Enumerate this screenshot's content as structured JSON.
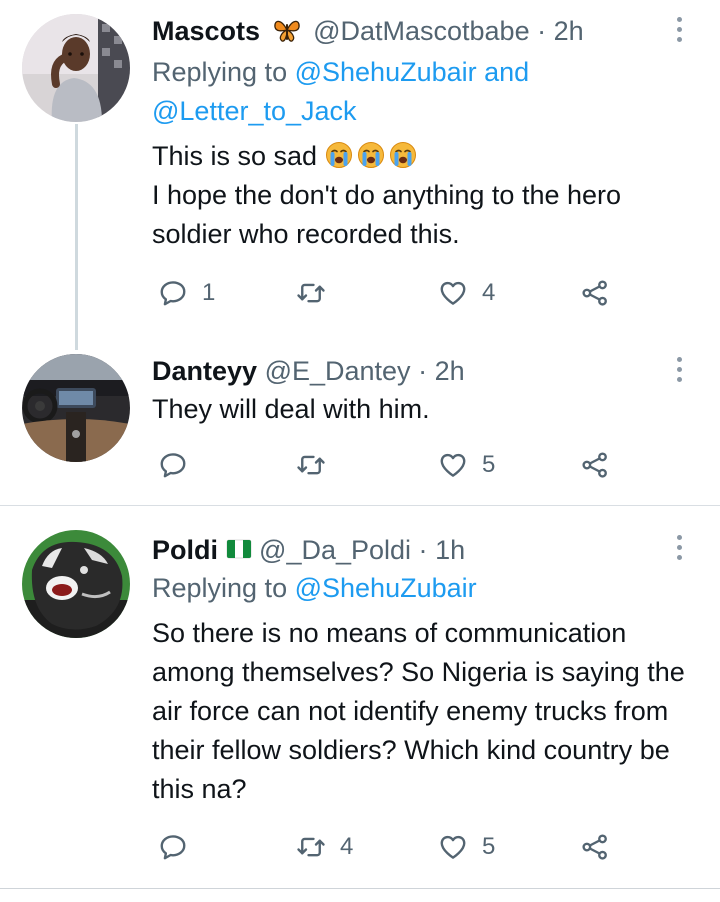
{
  "tweets": [
    {
      "name": "Mascots",
      "name_emoji": "butterfly-emoji",
      "handle": "@DatMascotbabe",
      "dot": "·",
      "time": "2h",
      "replying_prefix": "Replying to",
      "replying_to_1": "@ShehuZubair",
      "replying_and": "and",
      "replying_to_2": "@Letter_to_Jack",
      "text_line1": "This is so sad",
      "text_line1_emoji": "crying-face-emoji ×3",
      "text_rest": "I hope the don't do anything to the hero soldier who recorded this.",
      "actions": {
        "reply": "1",
        "retweet": "",
        "like": "4"
      }
    },
    {
      "name": "Danteyy",
      "handle": "@E_Dantey",
      "dot": "·",
      "time": "2h",
      "text": "They will deal with him.",
      "actions": {
        "reply": "",
        "retweet": "",
        "like": "5"
      }
    },
    {
      "name": "Poldi",
      "name_emoji": "nigeria-flag-emoji",
      "handle": "@_Da_Poldi",
      "dot": "·",
      "time": "1h",
      "replying_prefix": "Replying to",
      "replying_to_1": "@ShehuZubair",
      "text": "So there is no means of communication among themselves? So Nigeria is saying the air force can not identify enemy trucks from their fellow soldiers? Which kind country be this na?",
      "actions": {
        "reply": "",
        "retweet": "4",
        "like": "5"
      }
    }
  ],
  "colors": {
    "text": "#0f1419",
    "secondary": "#536471",
    "link": "#1d9bf0",
    "divider": "#d9dee3",
    "thread_line": "#cfd9de"
  }
}
